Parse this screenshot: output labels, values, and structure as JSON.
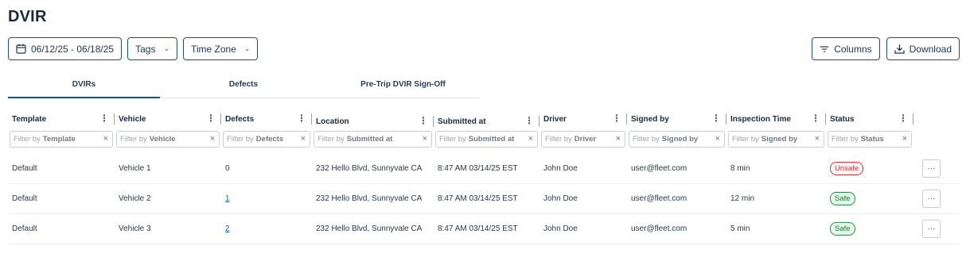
{
  "page": {
    "title": "DVIR"
  },
  "toolbar": {
    "date_range": "06/12/25 - 06/18/25",
    "tags_label": "Tags",
    "timezone_label": "Time Zone",
    "columns_label": "Columns",
    "download_label": "Download"
  },
  "tabs": [
    {
      "label": "DVIRs",
      "active": true
    },
    {
      "label": "Defects",
      "active": false
    },
    {
      "label": "Pre-Trip DVIR Sign-Off",
      "active": false
    }
  ],
  "columns": [
    {
      "label": "Template",
      "filter_prefix": "Filter by",
      "filter_field": "Template"
    },
    {
      "label": "Vehicle",
      "filter_prefix": "Filter by",
      "filter_field": "Vehicle"
    },
    {
      "label": "Defects",
      "filter_prefix": "Filter by",
      "filter_field": "Defects"
    },
    {
      "label": "Location",
      "filter_prefix": "Filter by",
      "filter_field": "Submitted at"
    },
    {
      "label": "Submitted at",
      "filter_prefix": "Filter by",
      "filter_field": "Submitted at"
    },
    {
      "label": "Driver",
      "filter_prefix": "Filter by",
      "filter_field": "Driver"
    },
    {
      "label": "Signed by",
      "filter_prefix": "Filter by",
      "filter_field": "Signed by"
    },
    {
      "label": "Inspection Time",
      "filter_prefix": "Filter by",
      "filter_field": "Signed by"
    },
    {
      "label": "Status",
      "filter_prefix": "Filter by",
      "filter_field": "Status"
    }
  ],
  "rows": [
    {
      "template": "Default",
      "vehicle": "Vehicle 1",
      "defects": "0",
      "location": "232 Hello Blvd, Sunnyvale CA",
      "submitted_at": "8:47 AM 03/14/25 EST",
      "driver": "John Doe",
      "signed_by": "user@fleet.com",
      "inspection_time": "8 min",
      "status": "Unsafe",
      "more": "···"
    },
    {
      "template": "Default",
      "vehicle": "Vehicle 2",
      "defects": "1",
      "location": "232 Hello Blvd, Sunnyvale CA",
      "submitted_at": "8:47 AM 03/14/25 EST",
      "driver": "John Doe",
      "signed_by": "user@fleet.com",
      "inspection_time": "12 min",
      "status": "Safe",
      "more": "···"
    },
    {
      "template": "Default",
      "vehicle": "Vehicle 3",
      "defects": "2",
      "location": "232 Hello Blvd, Sunnyvale CA",
      "submitted_at": "8:47 AM 03/14/25 EST",
      "driver": "John Doe",
      "signed_by": "user@fleet.com",
      "inspection_time": "5 min",
      "status": "Safe",
      "more": "···"
    }
  ],
  "icons": {
    "calendar": "calendar-icon",
    "chevron": "chevron-down-icon",
    "filter_lines": "filter-lines-icon",
    "download": "download-icon",
    "kebab": "kebab-icon",
    "clear": "clear-icon"
  },
  "colors": {
    "accent": "#1d4f7c",
    "link": "#1f5fa8",
    "unsafe": "#c63a44",
    "safe": "#2e8b4d"
  }
}
